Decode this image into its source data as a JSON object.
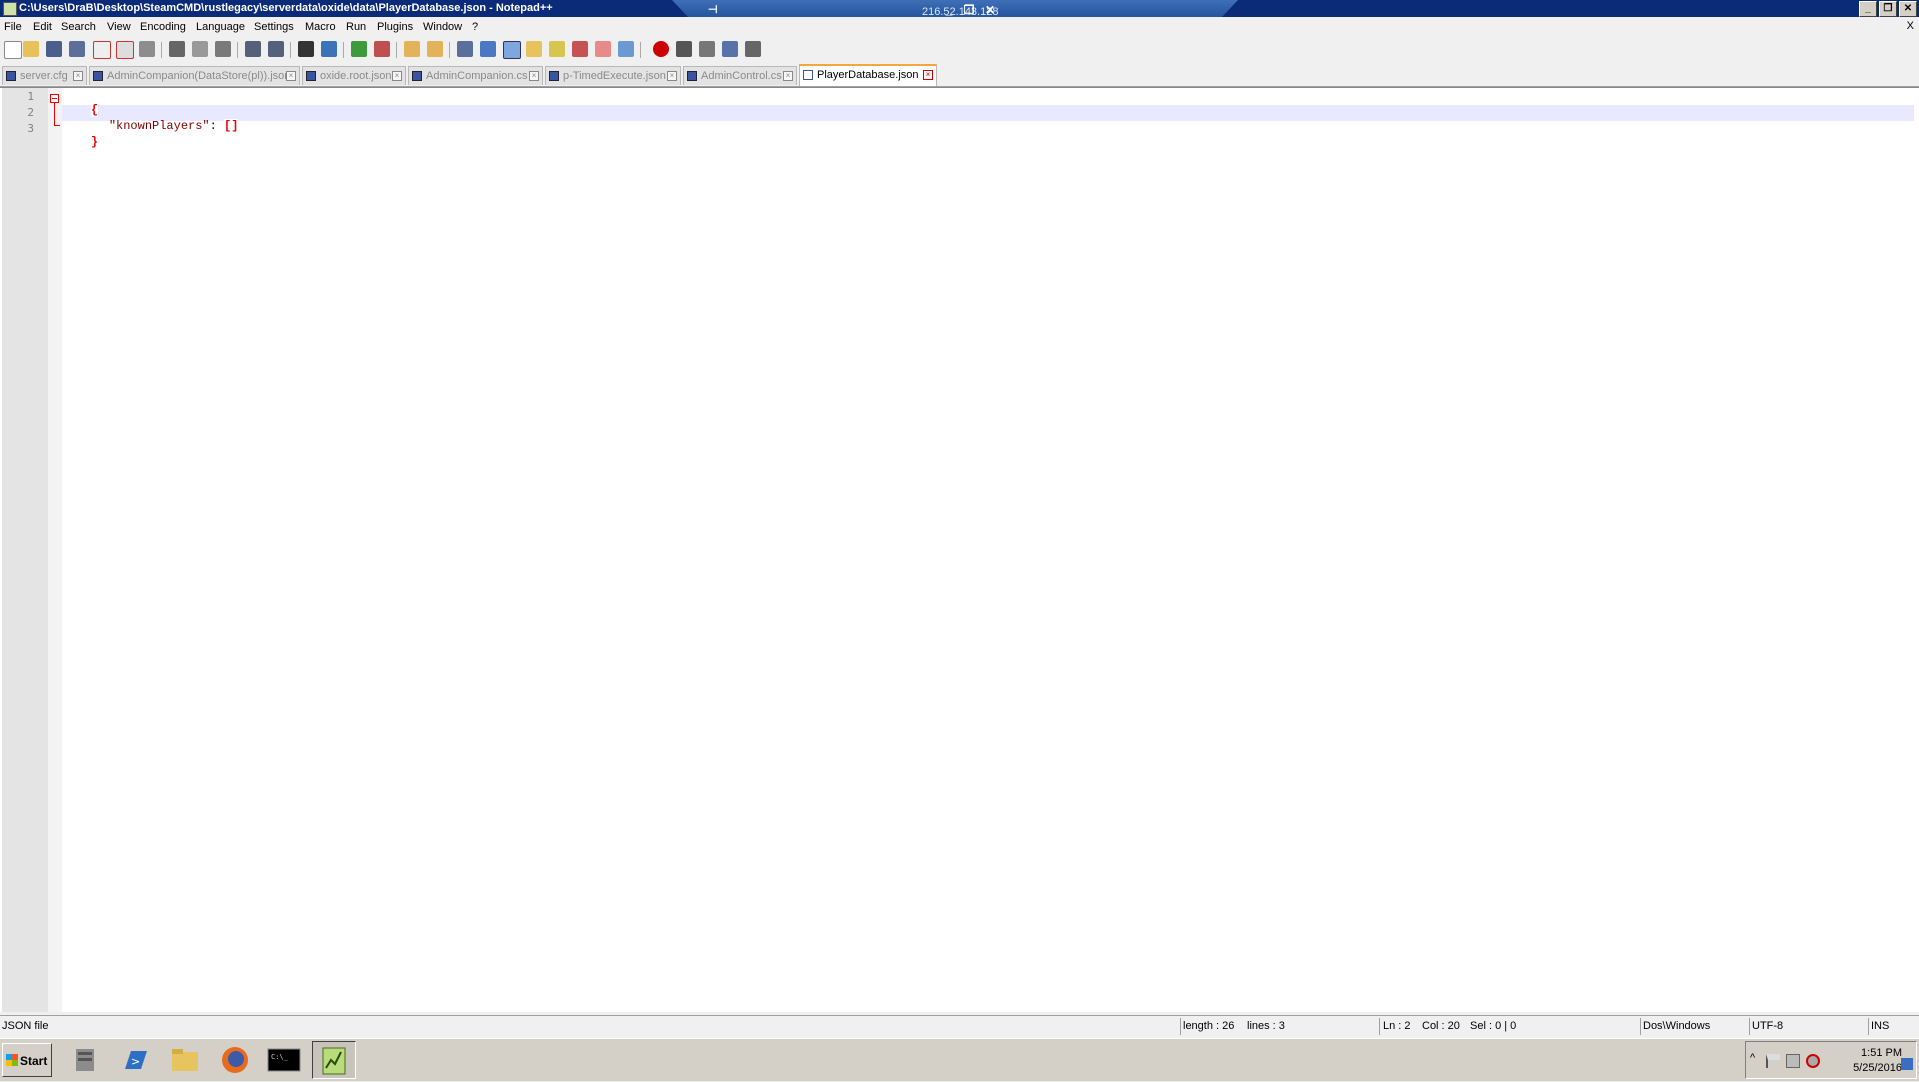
{
  "window": {
    "title": "C:\\Users\\DraB\\Desktop\\SteamCMD\\rustlegacy\\serverdata\\oxide\\data\\PlayerDatabase.json - Notepad++",
    "minimize": "_",
    "restore": "❐",
    "close": "✕"
  },
  "rdp": {
    "ip": "216.52.143.128",
    "pin": "⊣",
    "minimize": "_",
    "restore": "❐",
    "close": "✕"
  },
  "menu": {
    "items": [
      "File",
      "Edit",
      "Search",
      "View",
      "Encoding",
      "Language",
      "Settings",
      "Macro",
      "Run",
      "Plugins",
      "Window",
      "?"
    ],
    "close_doc": "X"
  },
  "tabs": [
    {
      "label": "server.cfg",
      "active": false
    },
    {
      "label": "AdminCompanion(DataStore(pl)).json",
      "active": false
    },
    {
      "label": "oxide.root.json",
      "active": false
    },
    {
      "label": "AdminCompanion.cs",
      "active": false
    },
    {
      "label": "p-TimedExecute.json",
      "active": false
    },
    {
      "label": "AdminControl.cs",
      "active": false
    },
    {
      "label": "PlayerDatabase.json",
      "active": true
    }
  ],
  "editor": {
    "line_numbers": [
      "1",
      "2",
      "3"
    ],
    "lines": {
      "l1": "{",
      "l2_key": "\"knownPlayers\"",
      "l2_colon": ": ",
      "l2_open": "[",
      "l2_close": "]",
      "l3": "}"
    }
  },
  "status": {
    "filetype": "JSON file",
    "length": "length : 26",
    "lines": "lines : 3",
    "ln": "Ln : 2",
    "col": "Col : 20",
    "sel": "Sel : 0 | 0",
    "eol": "Dos\\Windows",
    "encoding": "UTF-8",
    "mode": "INS"
  },
  "taskbar": {
    "start": "Start",
    "time": "1:51 PM",
    "date": "5/25/2016",
    "apps": [
      "server-manager",
      "powershell",
      "file-explorer",
      "firefox",
      "command-prompt",
      "notepad-plus-plus"
    ]
  },
  "colors": {
    "titlebar": "#0b2a78",
    "active_tab_accent": "#f4a640",
    "json_key": "#800000",
    "brace_match": "#e00000",
    "current_line": "#e8e8ff"
  }
}
